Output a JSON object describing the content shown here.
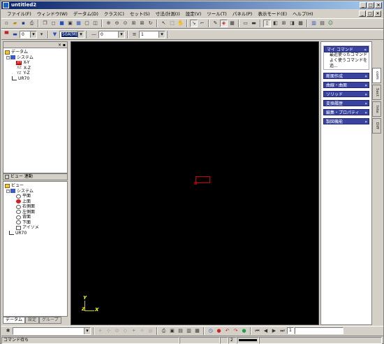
{
  "window": {
    "title": "untitled2",
    "minimize": "_",
    "maximize": "□",
    "close": "×"
  },
  "menu": [
    "ファイル(F)",
    "ウィンドウ(W)",
    "データム(D)",
    "クラス(C)",
    "セット(S)",
    "寸法/計測(I)",
    "設定(V)",
    "ツール(T)",
    "パネル(P)",
    "表示モード(E)",
    "ヘルプ(H)"
  ],
  "toolbar2": {
    "layer_value": "0",
    "scale_value": "50A(M)",
    "line_value": "0",
    "width_value": "1"
  },
  "tree_top": {
    "header": "データム",
    "items": [
      "データム",
      "システム",
      "X-Y",
      "X-Z",
      "Y-Z",
      "UR70"
    ],
    "xy_badge": "XY",
    "xz_badge": "XZ",
    "yz_badge": "YZ"
  },
  "splitter_label": "ビュー 連動",
  "tree_bottom": {
    "items": [
      "ビュー",
      "システム",
      "平面",
      "上面",
      "右側面",
      "左側面",
      "背面",
      "下面",
      "アイソメ",
      "UR70"
    ]
  },
  "left_tabs": [
    "データム",
    "設定",
    "グループ"
  ],
  "viewport": {
    "axis_y": "Y",
    "axis_x": "X",
    "axis_z": "Z"
  },
  "right_panel": {
    "my_commands": "マイ コマンド",
    "cmd_items": [
      "最近使ったコマンド",
      "よく使うコマンドを追..."
    ],
    "sections": [
      "断面作成",
      "曲線・曲面",
      "ソリッド",
      "変換履歴",
      "編集・プロパティ",
      "製図機能"
    ]
  },
  "side_tabs": [
    "com",
    "Sect",
    "Inte",
    "Diff"
  ],
  "status": {
    "message": "コマンド待ち",
    "page": "1",
    "scroll_value": "2"
  }
}
